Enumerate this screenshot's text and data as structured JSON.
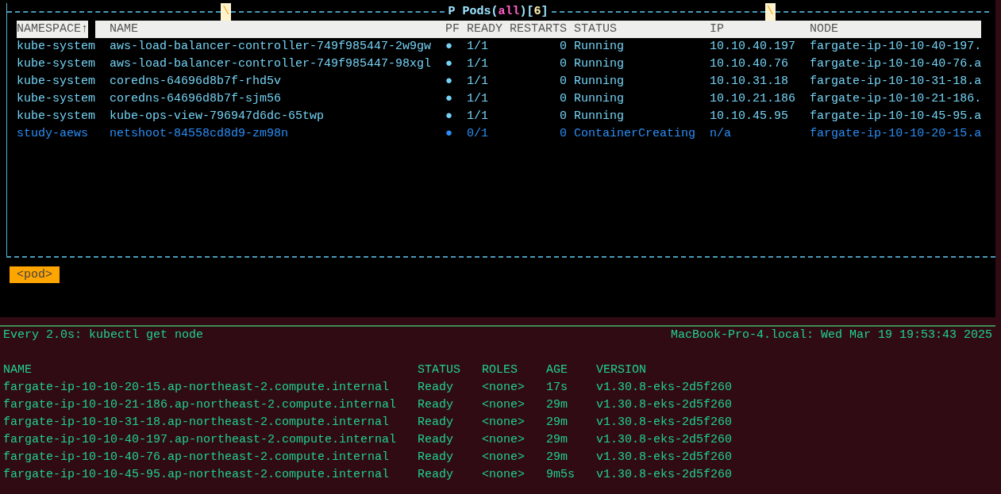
{
  "pods_view": {
    "title_marks": [
      "\\",
      "\\"
    ],
    "title": [
      {
        "text": "P Pods(",
        "color": "#9fe3ff"
      },
      {
        "text": "all",
        "color": "#ff5fc4"
      },
      {
        "text": ")[",
        "color": "#9fe3ff"
      },
      {
        "text": "6",
        "color": "#fff3b0"
      },
      {
        "text": "]",
        "color": "#9fe3ff"
      }
    ],
    "columns": [
      "NAMESPACE↑",
      "NAME",
      "PF",
      "READY",
      "RESTARTS",
      "STATUS",
      "IP",
      "NODE"
    ],
    "rows": [
      {
        "namespace": "kube-system",
        "name": "aws-load-balancer-controller-749f985447-2w9gw",
        "pf": "●",
        "ready": "1/1",
        "restarts": "0",
        "status": "Running",
        "ip": "10.10.40.197",
        "node": "fargate-ip-10-10-40-197.",
        "color": "#74d3f5"
      },
      {
        "namespace": "kube-system",
        "name": "aws-load-balancer-controller-749f985447-98xgl",
        "pf": "●",
        "ready": "1/1",
        "restarts": "0",
        "status": "Running",
        "ip": "10.10.40.76",
        "node": "fargate-ip-10-10-40-76.a",
        "color": "#74d3f5"
      },
      {
        "namespace": "kube-system",
        "name": "coredns-64696d8b7f-rhd5v",
        "pf": "●",
        "ready": "1/1",
        "restarts": "0",
        "status": "Running",
        "ip": "10.10.31.18",
        "node": "fargate-ip-10-10-31-18.a",
        "color": "#74d3f5"
      },
      {
        "namespace": "kube-system",
        "name": "coredns-64696d8b7f-sjm56",
        "pf": "●",
        "ready": "1/1",
        "restarts": "0",
        "status": "Running",
        "ip": "10.10.21.186",
        "node": "fargate-ip-10-10-21-186.",
        "color": "#74d3f5"
      },
      {
        "namespace": "kube-system",
        "name": "kube-ops-view-796947d6dc-65twp",
        "pf": "●",
        "ready": "1/1",
        "restarts": "0",
        "status": "Running",
        "ip": "10.10.45.95",
        "node": "fargate-ip-10-10-45-95.a",
        "color": "#74d3f5"
      },
      {
        "namespace": "study-aews",
        "name": "netshoot-84558cd8d9-zm98n",
        "pf": "●",
        "ready": "0/1",
        "restarts": "0",
        "status": "ContainerCreating",
        "ip": "n/a",
        "node": "fargate-ip-10-10-20-15.a",
        "color": "#2b8ef5"
      }
    ],
    "crumb": "<pod>"
  },
  "watch": {
    "command": "Every 2.0s: kubectl get node",
    "host_time": "MacBook-Pro-4.local: Wed Mar 19 19:53:43 2025",
    "columns": [
      "NAME",
      "STATUS",
      "ROLES",
      "AGE",
      "VERSION"
    ],
    "rows": [
      [
        "fargate-ip-10-10-20-15.ap-northeast-2.compute.internal",
        "Ready",
        "<none>",
        "17s",
        "v1.30.8-eks-2d5f260"
      ],
      [
        "fargate-ip-10-10-21-186.ap-northeast-2.compute.internal",
        "Ready",
        "<none>",
        "29m",
        "v1.30.8-eks-2d5f260"
      ],
      [
        "fargate-ip-10-10-31-18.ap-northeast-2.compute.internal",
        "Ready",
        "<none>",
        "29m",
        "v1.30.8-eks-2d5f260"
      ],
      [
        "fargate-ip-10-10-40-197.ap-northeast-2.compute.internal",
        "Ready",
        "<none>",
        "29m",
        "v1.30.8-eks-2d5f260"
      ],
      [
        "fargate-ip-10-10-40-76.ap-northeast-2.compute.internal",
        "Ready",
        "<none>",
        "29m",
        "v1.30.8-eks-2d5f260"
      ],
      [
        "fargate-ip-10-10-45-95.ap-northeast-2.compute.internal",
        "Ready",
        "<none>",
        "9m5s",
        "v1.30.8-eks-2d5f260"
      ]
    ]
  }
}
